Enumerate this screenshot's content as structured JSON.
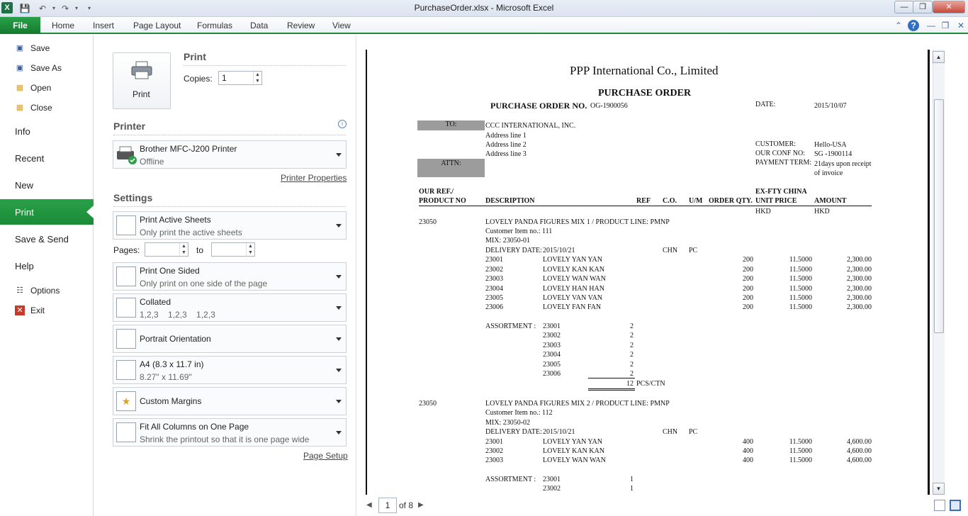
{
  "window": {
    "title": "PurchaseOrder.xlsx - Microsoft Excel"
  },
  "ribbon": {
    "file": "File",
    "tabs": [
      "Home",
      "Insert",
      "Page Layout",
      "Formulas",
      "Data",
      "Review",
      "View"
    ]
  },
  "backstage": {
    "commands": [
      "Save",
      "Save As",
      "Open",
      "Close"
    ],
    "nav": [
      "Info",
      "Recent",
      "New",
      "Print",
      "Save & Send",
      "Help"
    ],
    "bottom": [
      "Options",
      "Exit"
    ]
  },
  "print": {
    "header": "Print",
    "button": "Print",
    "copies_label": "Copies:",
    "copies_value": "1",
    "printer_header": "Printer",
    "printer_name": "Brother MFC-J200 Printer",
    "printer_status": "Offline",
    "printer_properties": "Printer Properties",
    "settings_header": "Settings",
    "pages_label": "Pages:",
    "to_label": "to",
    "page_setup": "Page Setup",
    "settings": [
      {
        "title": "Print Active Sheets",
        "sub": "Only print the active sheets"
      },
      {
        "title": "Print One Sided",
        "sub": "Only print on one side of the page"
      },
      {
        "title": "Collated",
        "sub": "1,2,3    1,2,3    1,2,3"
      },
      {
        "title": "Portrait Orientation",
        "sub": ""
      },
      {
        "title": "A4 (8.3 x 11.7 in)",
        "sub": "8.27\" x 11.69\""
      },
      {
        "title": "Custom Margins",
        "sub": ""
      },
      {
        "title": "Fit All Columns on One Page",
        "sub": "Shrink the printout so that it is one page wide"
      }
    ]
  },
  "preview": {
    "company": "PPP International Co., Limited",
    "doc_title": "PURCHASE ORDER",
    "po_label": "PURCHASE ORDER NO.",
    "po_no": "OG-1900056",
    "date_label": "DATE:",
    "date": "2015/10/07",
    "to_label": "TO:",
    "attn_label": "ATTN:",
    "to_name": "CCC INTERNATIONAL, INC.",
    "address": [
      "Address line 1",
      "Address line 2",
      "Address line 3"
    ],
    "customer_label": "CUSTOMER:",
    "customer": "Hello-USA",
    "conf_label": "OUR CONF NO:",
    "conf": "SG -1900114",
    "payment_label": "PAYMENT TERM:",
    "payment": "21days upon receipt",
    "payment2": "of invoice",
    "col_ourref": "OUR REF./",
    "col_product": "PRODUCT NO",
    "col_desc": "DESCRIPTION",
    "col_ref": "REF",
    "col_co": "C.O.",
    "col_um": "U/M",
    "col_qty": "ORDER QTY.",
    "col_exfty": "EX-FTY CHINA",
    "col_unitprice": "UNIT PRICE",
    "col_amount": "AMOUNT",
    "currency1": "HKD",
    "currency2": "HKD",
    "product_no": "23050",
    "block1": {
      "desc": "LOVELY PANDA FIGURES MIX 1 / PRODUCT LINE: PMNP",
      "item": "Customer Item no.: 111",
      "mix": "MIX: 23050-01",
      "delivery_label": "DELIVERY DATE:",
      "delivery": "2015/10/21",
      "co": "CHN",
      "um": "PC",
      "lines": [
        {
          "code": "23001",
          "name": "LOVELY YAN YAN",
          "qty": "200",
          "price": "11.5000",
          "amount": "2,300.00"
        },
        {
          "code": "23002",
          "name": "LOVELY KAN KAN",
          "qty": "200",
          "price": "11.5000",
          "amount": "2,300.00"
        },
        {
          "code": "23003",
          "name": "LOVELY WAN WAN",
          "qty": "200",
          "price": "11.5000",
          "amount": "2,300.00"
        },
        {
          "code": "23004",
          "name": "LOVELY HAN HAN",
          "qty": "200",
          "price": "11.5000",
          "amount": "2,300.00"
        },
        {
          "code": "23005",
          "name": "LOVELY VAN VAN",
          "qty": "200",
          "price": "11.5000",
          "amount": "2,300.00"
        },
        {
          "code": "23006",
          "name": "LOVELY FAN FAN",
          "qty": "200",
          "price": "11.5000",
          "amount": "2,300.00"
        }
      ],
      "assortment_label": "ASSORTMENT :",
      "assortment": [
        {
          "code": "23001",
          "qty": "2"
        },
        {
          "code": "23002",
          "qty": "2"
        },
        {
          "code": "23003",
          "qty": "2"
        },
        {
          "code": "23004",
          "qty": "2"
        },
        {
          "code": "23005",
          "qty": "2"
        },
        {
          "code": "23006",
          "qty": "2"
        }
      ],
      "total": "12",
      "total_unit": "PCS/CTN"
    },
    "block2": {
      "desc": "LOVELY PANDA FIGURES MIX 2 / PRODUCT LINE: PMNP",
      "item": "Customer Item no.: 112",
      "mix": "MIX: 23050-02",
      "delivery_label": "DELIVERY DATE:",
      "delivery": "2015/10/21",
      "co": "CHN",
      "um": "PC",
      "lines": [
        {
          "code": "23001",
          "name": "LOVELY YAN YAN",
          "qty": "400",
          "price": "11.5000",
          "amount": "4,600.00"
        },
        {
          "code": "23002",
          "name": "LOVELY KAN KAN",
          "qty": "400",
          "price": "11.5000",
          "amount": "4,600.00"
        },
        {
          "code": "23003",
          "name": "LOVELY WAN WAN",
          "qty": "400",
          "price": "11.5000",
          "amount": "4,600.00"
        }
      ],
      "assortment_label": "ASSORTMENT :",
      "assortment": [
        {
          "code": "23001",
          "qty": "1"
        },
        {
          "code": "23002",
          "qty": "1"
        }
      ]
    }
  },
  "pager": {
    "current": "1",
    "of": "of 8"
  }
}
